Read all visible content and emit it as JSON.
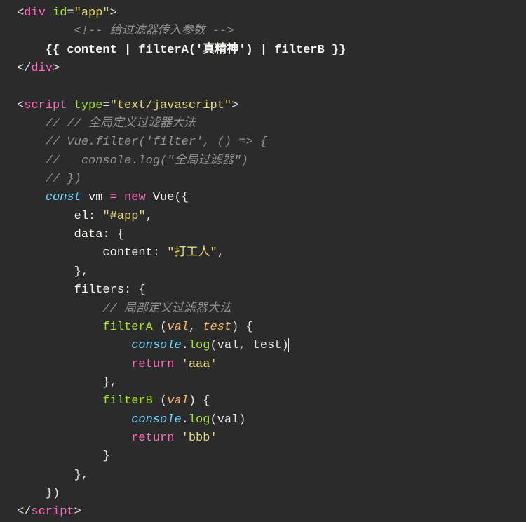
{
  "code": {
    "lines": [
      {
        "n": 1,
        "spans": [
          {
            "t": "<",
            "c": "punct"
          },
          {
            "t": "div",
            "c": "tag-name"
          },
          {
            "t": " ",
            "c": "punct"
          },
          {
            "t": "id",
            "c": "attr-name"
          },
          {
            "t": "=",
            "c": "punct"
          },
          {
            "t": "\"app\"",
            "c": "attr-val"
          },
          {
            "t": ">",
            "c": "punct"
          }
        ]
      },
      {
        "n": 2,
        "indent": 2,
        "spans": [
          {
            "t": "<!-- 给过滤器传入参数 -->",
            "c": "comment"
          }
        ]
      },
      {
        "n": 3,
        "indent": 1,
        "spans": [
          {
            "t": "{{ content | filterA('真精神') | filterB }}",
            "c": "text-b"
          }
        ]
      },
      {
        "n": 4,
        "spans": [
          {
            "t": "</",
            "c": "punct"
          },
          {
            "t": "div",
            "c": "tag-name"
          },
          {
            "t": ">",
            "c": "punct"
          }
        ]
      },
      {
        "n": 5,
        "spans": []
      },
      {
        "n": 6,
        "spans": [
          {
            "t": "<",
            "c": "punct"
          },
          {
            "t": "script",
            "c": "tag-name"
          },
          {
            "t": " ",
            "c": "punct"
          },
          {
            "t": "type",
            "c": "attr-name"
          },
          {
            "t": "=",
            "c": "punct"
          },
          {
            "t": "\"text/javascript\"",
            "c": "attr-val"
          },
          {
            "t": ">",
            "c": "punct"
          }
        ]
      },
      {
        "n": 7,
        "indent": 1,
        "spans": [
          {
            "t": "// // 全局定义过滤器大法",
            "c": "comment"
          }
        ]
      },
      {
        "n": 8,
        "indent": 1,
        "spans": [
          {
            "t": "// Vue.filter('filter', () => {",
            "c": "comment"
          }
        ]
      },
      {
        "n": 9,
        "indent": 1,
        "spans": [
          {
            "t": "//   console.log(\"全局过滤器\")",
            "c": "comment"
          }
        ]
      },
      {
        "n": 10,
        "indent": 1,
        "spans": [
          {
            "t": "// })",
            "c": "comment"
          }
        ]
      },
      {
        "n": 11,
        "indent": 1,
        "spans": [
          {
            "t": "const",
            "c": "kw"
          },
          {
            "t": " ",
            "c": "var"
          },
          {
            "t": "vm",
            "c": "var"
          },
          {
            "t": " ",
            "c": "var"
          },
          {
            "t": "=",
            "c": "op"
          },
          {
            "t": " ",
            "c": "var"
          },
          {
            "t": "new",
            "c": "kw-new"
          },
          {
            "t": " ",
            "c": "var"
          },
          {
            "t": "Vue",
            "c": "cls"
          },
          {
            "t": "({",
            "c": "punct"
          }
        ]
      },
      {
        "n": 12,
        "indent": 2,
        "spans": [
          {
            "t": "el",
            "c": "prop"
          },
          {
            "t": ": ",
            "c": "punct"
          },
          {
            "t": "\"#app\"",
            "c": "str"
          },
          {
            "t": ",",
            "c": "punct"
          }
        ]
      },
      {
        "n": 13,
        "indent": 2,
        "spans": [
          {
            "t": "data",
            "c": "prop"
          },
          {
            "t": ": {",
            "c": "punct"
          }
        ]
      },
      {
        "n": 14,
        "indent": 3,
        "spans": [
          {
            "t": "content",
            "c": "prop"
          },
          {
            "t": ": ",
            "c": "punct"
          },
          {
            "t": "\"打工人\"",
            "c": "str"
          },
          {
            "t": ",",
            "c": "punct"
          }
        ]
      },
      {
        "n": 15,
        "indent": 2,
        "spans": [
          {
            "t": "},",
            "c": "punct"
          }
        ]
      },
      {
        "n": 16,
        "indent": 2,
        "spans": [
          {
            "t": "filters",
            "c": "prop"
          },
          {
            "t": ": {",
            "c": "punct"
          }
        ]
      },
      {
        "n": 17,
        "indent": 3,
        "spans": [
          {
            "t": "// 局部定义过滤器大法",
            "c": "comment"
          }
        ]
      },
      {
        "n": 18,
        "indent": 3,
        "spans": [
          {
            "t": "filterA",
            "c": "func"
          },
          {
            "t": " (",
            "c": "punct"
          },
          {
            "t": "val",
            "c": "param"
          },
          {
            "t": ", ",
            "c": "punct"
          },
          {
            "t": "test",
            "c": "param"
          },
          {
            "t": ") {",
            "c": "punct"
          }
        ]
      },
      {
        "n": 19,
        "indent": 4,
        "spans": [
          {
            "t": "console",
            "c": "builtin"
          },
          {
            "t": ".",
            "c": "punct"
          },
          {
            "t": "log",
            "c": "func"
          },
          {
            "t": "(val, test)",
            "c": "punct"
          }
        ],
        "cursor": true
      },
      {
        "n": 20,
        "indent": 4,
        "spans": [
          {
            "t": "return",
            "c": "kw-new"
          },
          {
            "t": " ",
            "c": "var"
          },
          {
            "t": "'aaa'",
            "c": "str"
          }
        ]
      },
      {
        "n": 21,
        "indent": 3,
        "spans": [
          {
            "t": "},",
            "c": "punct"
          }
        ]
      },
      {
        "n": 22,
        "indent": 3,
        "spans": [
          {
            "t": "filterB",
            "c": "func"
          },
          {
            "t": " (",
            "c": "punct"
          },
          {
            "t": "val",
            "c": "param"
          },
          {
            "t": ") {",
            "c": "punct"
          }
        ]
      },
      {
        "n": 23,
        "indent": 4,
        "spans": [
          {
            "t": "console",
            "c": "builtin"
          },
          {
            "t": ".",
            "c": "punct"
          },
          {
            "t": "log",
            "c": "func"
          },
          {
            "t": "(val)",
            "c": "punct"
          }
        ]
      },
      {
        "n": 24,
        "indent": 4,
        "spans": [
          {
            "t": "return",
            "c": "kw-new"
          },
          {
            "t": " ",
            "c": "var"
          },
          {
            "t": "'bbb'",
            "c": "str"
          }
        ]
      },
      {
        "n": 25,
        "indent": 3,
        "spans": [
          {
            "t": "}",
            "c": "punct"
          }
        ]
      },
      {
        "n": 26,
        "indent": 2,
        "spans": [
          {
            "t": "},",
            "c": "punct"
          }
        ]
      },
      {
        "n": 27,
        "indent": 1,
        "spans": [
          {
            "t": "})",
            "c": "punct"
          }
        ]
      },
      {
        "n": 28,
        "spans": [
          {
            "t": "</",
            "c": "punct"
          },
          {
            "t": "script",
            "c": "tag-name"
          },
          {
            "t": ">",
            "c": "punct"
          }
        ]
      }
    ]
  },
  "indent_unit": "    "
}
